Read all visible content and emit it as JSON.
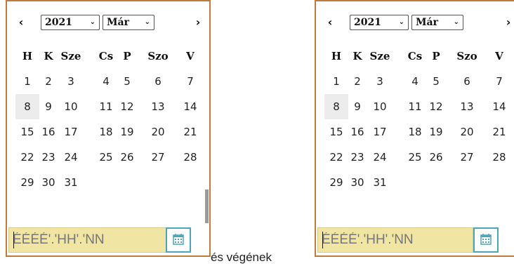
{
  "picker_left": {
    "year": "2021",
    "month": "Már",
    "prev_icon": "‹",
    "next_icon": "›",
    "chevron": "⌄",
    "weekdays": [
      "H",
      "K",
      "Sze",
      "Cs",
      "P",
      "Szo",
      "V"
    ],
    "weeks": [
      [
        "1",
        "2",
        "3",
        "4",
        "5",
        "6",
        "7"
      ],
      [
        "8",
        "9",
        "10",
        "11",
        "12",
        "13",
        "14"
      ],
      [
        "15",
        "16",
        "17",
        "18",
        "19",
        "20",
        "21"
      ],
      [
        "22",
        "23",
        "24",
        "25",
        "26",
        "27",
        "28"
      ],
      [
        "29",
        "30",
        "31",
        "",
        "",
        "",
        ""
      ]
    ],
    "highlighted_day": "8",
    "input_placeholder": "ÉÉÉÉ'.'HH'.'NN",
    "calendar_icon": "calendar-icon"
  },
  "picker_right": {
    "year": "2021",
    "month": "Már",
    "prev_icon": "‹",
    "next_icon": "›",
    "chevron": "⌄",
    "weekdays": [
      "H",
      "K",
      "Sze",
      "Cs",
      "P",
      "Szo",
      "V"
    ],
    "weeks": [
      [
        "1",
        "2",
        "3",
        "4",
        "5",
        "6",
        "7"
      ],
      [
        "8",
        "9",
        "10",
        "11",
        "12",
        "13",
        "14"
      ],
      [
        "15",
        "16",
        "17",
        "18",
        "19",
        "20",
        "21"
      ],
      [
        "22",
        "23",
        "24",
        "25",
        "26",
        "27",
        "28"
      ],
      [
        "29",
        "30",
        "31",
        "",
        "",
        "",
        ""
      ]
    ],
    "highlighted_day": "8",
    "input_placeholder": "ÉÉÉÉ'.'HH'.'NN",
    "calendar_icon": "calendar-icon"
  },
  "between_text": "és  végének",
  "colors": {
    "border": "#c07a3a",
    "input_bg": "#f0e5a3",
    "button_border": "#4aa6b8",
    "today_bg": "#ececec"
  }
}
